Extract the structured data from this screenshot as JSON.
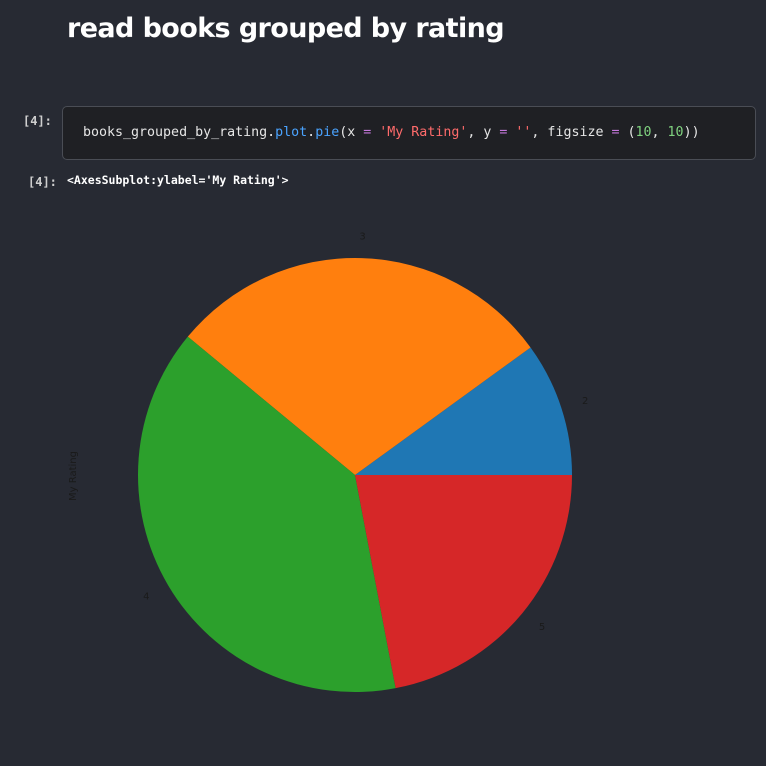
{
  "notebook": {
    "heading": "read books grouped by rating",
    "input_prompt": "[4]:",
    "output_prompt": "[4]:",
    "code": {
      "object": "books_grouped_by_rating",
      "dot1": ".",
      "attr1": "plot",
      "dot2": ".",
      "method": "pie",
      "open": "(x ",
      "eq1": "=",
      "sp1": " ",
      "str1": "'My Rating'",
      "comma1": ", y ",
      "eq2": "=",
      "sp2": " ",
      "str2": "''",
      "comma2": ", figsize ",
      "eq3": "=",
      "open2": " (",
      "num1": "10",
      "comma3": ", ",
      "num2": "10",
      "close": "))"
    },
    "output_text": "<AxesSubplot:ylabel='My Rating'>"
  },
  "chart_data": {
    "type": "pie",
    "categories": [
      "2",
      "3",
      "4",
      "5"
    ],
    "values": [
      10,
      29,
      39,
      22
    ],
    "colors": [
      "#1f77b4",
      "#ff7f0e",
      "#2ca02c",
      "#d62728"
    ],
    "startangle": 0,
    "direction": "counterclockwise",
    "ylabel": "My Rating",
    "xlabel": "",
    "title": "",
    "legend": "none"
  }
}
